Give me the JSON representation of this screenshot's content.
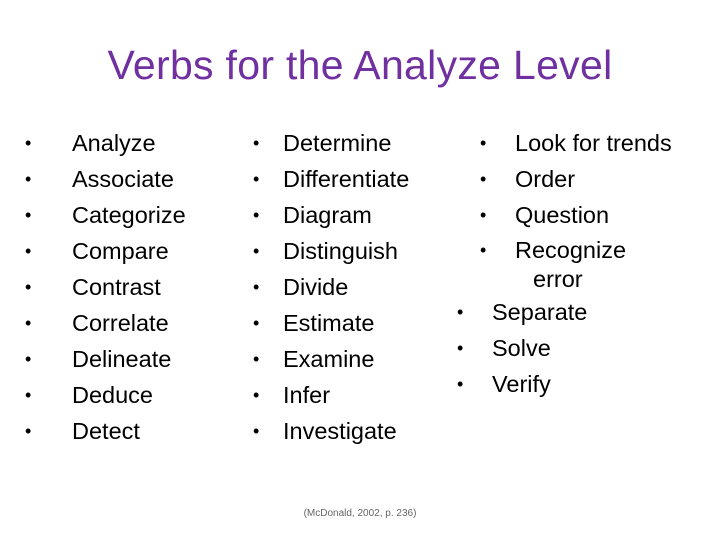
{
  "slide": {
    "title": "Verbs for the Analyze Level",
    "title_color": "#7030a0",
    "bullet_glyph": "•",
    "columns": [
      {
        "items": [
          "Analyze",
          "Associate",
          "Categorize",
          "Compare",
          "Contrast",
          "Correlate",
          "Delineate",
          "Deduce",
          "Detect"
        ]
      },
      {
        "items": [
          "Determine",
          "Differentiate",
          "Diagram",
          "Distinguish",
          "Divide",
          "Estimate",
          "Examine",
          "Infer",
          "Investigate"
        ]
      },
      {
        "items": [
          "Look for trends",
          "Order",
          "Question",
          "Recognize error",
          "Separate",
          "Solve",
          "Verify"
        ],
        "wrapped_item": {
          "line1": "Recognize",
          "line2": "error"
        }
      }
    ],
    "citation": "(McDonald, 2002, p. 236)"
  }
}
